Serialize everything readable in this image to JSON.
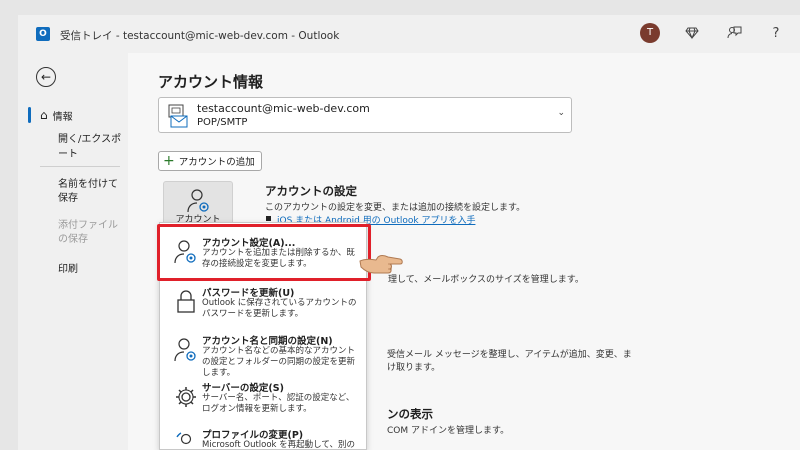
{
  "window": {
    "title": "受信トレイ - testaccount@mic-web-dev.com - Outlook",
    "avatar_initial": "T",
    "icons": [
      "diamond-icon",
      "feedback-icon",
      "help-icon"
    ],
    "help_label": "?"
  },
  "sidebar": {
    "back_icon": "back-arrow-icon",
    "items": [
      {
        "label": "情報",
        "active": true
      },
      {
        "label": "開く/エクスポート"
      },
      {
        "label": "名前を付けて保存"
      },
      {
        "label": "添付ファイルの保存",
        "disabled": true
      },
      {
        "label": "印刷"
      }
    ]
  },
  "main": {
    "page_title": "アカウント情報",
    "account": {
      "email": "testaccount@mic-web-dev.com",
      "type": "POP/SMTP"
    },
    "add_account_label": "アカウントの追加",
    "account_settings": {
      "button_label": "アカウント設定 ˅",
      "title": "アカウントの設定",
      "description": "このアカウントの設定を変更、または追加の接続を設定します。",
      "link": "iOS または Android 用の Outlook アプリを入手"
    },
    "background_fragments": {
      "mailbox": "理して、メールボックスのサイズを管理します。",
      "rules_1": "受信メール メッセージを整理し、アイテムが追加、変更、ま",
      "rules_2": "け取ります。",
      "addins_title": "ンの表示",
      "addins_desc": "COM アドインを管理します。"
    }
  },
  "menu": {
    "items": [
      {
        "icon": "account-settings-icon",
        "title": "アカウント設定(A)...",
        "desc": "アカウントを追加または削除するか、既存の接続設定を変更します。"
      },
      {
        "icon": "lock-icon",
        "title": "パスワードを更新(U)",
        "desc": "Outlook に保存されているアカウントのパスワードを更新します。"
      },
      {
        "icon": "account-sync-icon",
        "title": "アカウント名と同期の設定(N)",
        "desc": "アカウント名などの基本的なアカウントの設定とフォルダーの同期の設定を更新します。"
      },
      {
        "icon": "gear-icon",
        "title": "サーバーの設定(S)",
        "desc": "サーバー名、ポート、認証の設定など、ログオン情報を更新します。"
      },
      {
        "icon": "profile-change-icon",
        "title": "プロファイルの変更(P)",
        "desc": "Microsoft Outlook を再起動して、別の"
      }
    ]
  },
  "colors": {
    "accent": "#0f6cbd",
    "highlight": "#e0202a",
    "avatar": "#7a3b2e"
  }
}
